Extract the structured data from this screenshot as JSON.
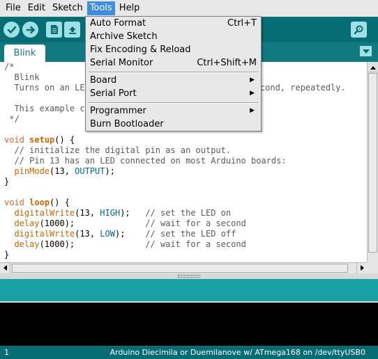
{
  "menubar": {
    "items": [
      {
        "label": "File",
        "active": false
      },
      {
        "label": "Edit",
        "active": false
      },
      {
        "label": "Sketch",
        "active": false
      },
      {
        "label": "Tools",
        "active": true
      },
      {
        "label": "Help",
        "active": false
      }
    ]
  },
  "toolbar": {
    "buttons": [
      "verify-icon",
      "upload-icon",
      "new-icon",
      "open-icon",
      "save-icon",
      "serial-monitor-icon"
    ]
  },
  "tabs": {
    "active": "Blink"
  },
  "tools_menu": {
    "items": [
      {
        "label": "Auto Format",
        "shortcut": "Ctrl+T"
      },
      {
        "label": "Archive Sketch",
        "shortcut": ""
      },
      {
        "label": "Fix Encoding & Reload",
        "shortcut": ""
      },
      {
        "label": "Serial Monitor",
        "shortcut": "Ctrl+Shift+M"
      },
      {
        "label": "Board",
        "submenu": true
      },
      {
        "label": "Serial Port",
        "submenu": true
      },
      {
        "label": "Programmer",
        "submenu": true
      },
      {
        "label": "Burn Bootloader",
        "shortcut": ""
      }
    ]
  },
  "editor": {
    "lines": [
      "/*",
      "  Blink",
      "  Turns on an LED",
      "",
      "  This example co",
      " */",
      "",
      "void setup() {",
      "  // initialize the digital pin as an output.",
      "  // Pin 13 has an LED connected on most Arduino boards:",
      "  pinMode(13, OUTPUT);",
      "}",
      "",
      "void loop() {",
      "  digitalWrite(13, HIGH);   // set the LED on",
      "  delay(1000);              // wait for a second",
      "  digitalWrite(13, LOW);    // set the LED off",
      "  delay(1000);              // wait for a second",
      "}"
    ],
    "line2_suffix": "e second, repeatedly."
  },
  "status": {
    "line": "1",
    "board": "Arduino Diecimila or Duemilanove w/ ATmega168 on /dev/ttyUSB0"
  },
  "colors": {
    "toolbar": "#066d74",
    "message_bar": "#17a1a5",
    "menu_highlight": "#3d8ee0"
  }
}
